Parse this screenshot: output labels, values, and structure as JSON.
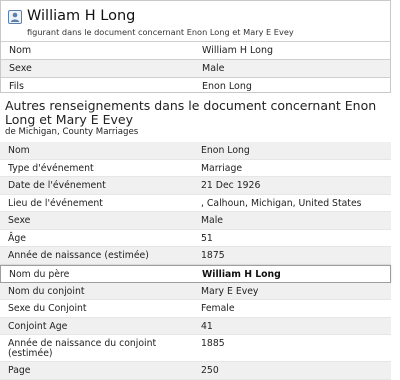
{
  "header": {
    "name": "William H Long",
    "subtitle": "figurant dans le document concernant Enon Long et Mary E Evey",
    "rows": [
      {
        "label": "Nom",
        "value": "William H Long",
        "is_link": false
      },
      {
        "label": "Sexe",
        "value": "Male",
        "is_link": false
      },
      {
        "label": "Fils",
        "value": "Enon Long",
        "is_link": true
      }
    ]
  },
  "section": {
    "title": "Autres renseignements dans le document concernant Enon Long et Mary E Evey",
    "source": "de Michigan, County Marriages"
  },
  "details": [
    {
      "label": "Nom",
      "value": "Enon Long",
      "is_link": true
    },
    {
      "label": "Type d'événement",
      "value": "Marriage"
    },
    {
      "label": "Date de l'événement",
      "value": "21 Dec 1926"
    },
    {
      "label": "Lieu de l'événement",
      "value": ", Calhoun, Michigan, United States"
    },
    {
      "label": "Sexe",
      "value": "Male"
    },
    {
      "label": "Âge",
      "value": "51"
    },
    {
      "label": "Année de naissance (estimée)",
      "value": "1875"
    },
    {
      "label": "Nom du père",
      "value": "William H Long",
      "highlighted": true
    },
    {
      "label": "Nom du conjoint",
      "value": "Mary E Evey",
      "is_link": true
    },
    {
      "label": "Sexe du Conjoint",
      "value": "Female"
    },
    {
      "label": "Conjoint Age",
      "value": "41"
    },
    {
      "label": "Année de naissance du conjoint (estimée)",
      "value": "1885"
    },
    {
      "label": "Page",
      "value": "250"
    }
  ],
  "colors": {
    "link": "#1f5aa6",
    "border": "#c9c9c9",
    "alt_row": "#f0f0f0"
  },
  "icons": {
    "person": "person-icon"
  }
}
